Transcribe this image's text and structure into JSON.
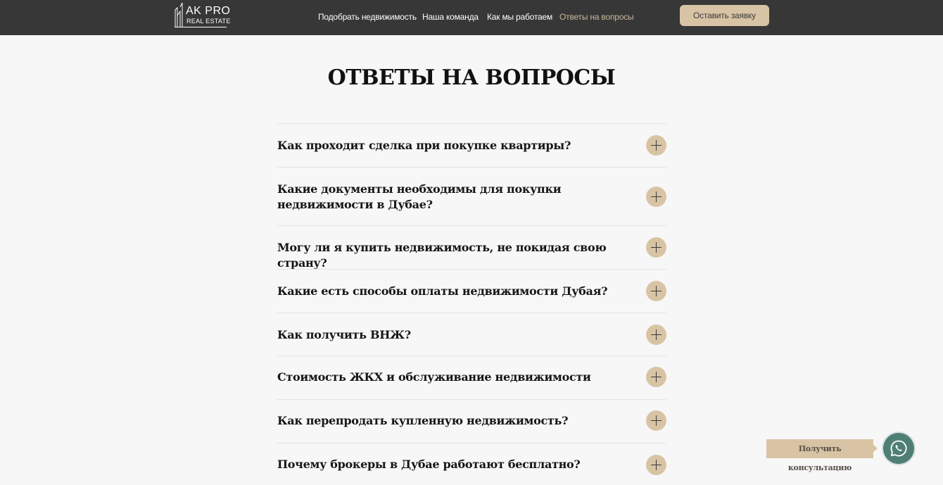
{
  "header": {
    "logo": {
      "top": "AK PRO",
      "bottom": "REAL ESTATE"
    },
    "nav": [
      {
        "label": "Подобрать недвижимость",
        "active": false
      },
      {
        "label": "Наша команда",
        "active": false
      },
      {
        "label": "Как мы работаем",
        "active": false
      },
      {
        "label": "Ответы на вопросы",
        "active": true
      }
    ],
    "cta_label": "Оставить заявку"
  },
  "main": {
    "title": "ОТВЕТЫ НА ВОПРОСЫ",
    "faq": [
      {
        "question": "Как проходит сделка при покупке квартиры?"
      },
      {
        "question": "Какие документы необходимы для покупки недвижимости в Дубае?"
      },
      {
        "question": "Могу ли я купить недвижимость, не покидая свою страну?"
      },
      {
        "question": "Какие есть способы оплаты недвижимости Дубая?"
      },
      {
        "question": "Как получить ВНЖ?"
      },
      {
        "question": "Стоимость ЖКХ и обслуживание недвижимости"
      },
      {
        "question": "Как перепродать купленную недвижимость?"
      },
      {
        "question": "Почему брокеры в Дубае работают бесплатно?"
      }
    ]
  },
  "floating": {
    "consult_label": "Получить консультацию",
    "button_icon": "whatsapp-icon"
  },
  "colors": {
    "header_bg": "#373737",
    "accent": "#d8c4a5",
    "active_nav": "#c9b89f",
    "whatsapp": "#4f7f74",
    "page_bg": "#f7f7f7"
  }
}
